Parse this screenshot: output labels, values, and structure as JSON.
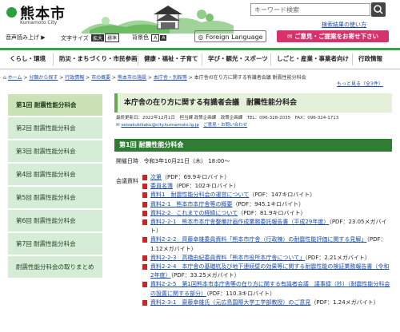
{
  "header": {
    "logo_title": "熊本市",
    "logo_sub": "Kumamoto City",
    "search_placeholder": "キーワード検索",
    "search_detail_link": "検索結果の使い方",
    "voice": "音声読み上げ",
    "text_size_label": "文字サイズ",
    "text_size_large": "拡大",
    "text_size_standard": "標準",
    "bg_color_label": "背景色",
    "bg_a1": "A",
    "bg_a2": "A",
    "language": "Foreign Language",
    "opinion": "ご意見・ご提案をお寄せ下さい"
  },
  "nav": [
    "くらし・環境",
    "防災・まちづくり・市民参画",
    "健康・福祉・子育て",
    "学び・観光・スポーツ",
    "しごと・産業・事業者向け",
    "行政情報"
  ],
  "breadcrumb": [
    "ホーム",
    "分類から探す",
    "行政情報",
    "市の概要",
    "熊本市の施設",
    "本庁舎・別館等"
  ],
  "breadcrumb_current": "本庁舎の在り方に関する有識者会議 耐震性能分科会",
  "upper_link": "もっと見る（全3件）",
  "sidebar": [
    "第1回 耐震性能分科会",
    "第2回 耐震性能分科会",
    "第3回 耐震性能分科会",
    "第4回 耐震性能分科会",
    "第5回 耐震性能分科会",
    "第6回 耐震性能分科会",
    "第7回 耐震性能分科会",
    "耐震性能分科会の取りまとめ"
  ],
  "main": {
    "title": "本庁舎の在り方に関する有識者会議　耐震性能分科会",
    "meta": "最終更新日：2022年12月1日　担当課 政策企画課　政策企画課　TEL：096-328-2035　FAX：096-324-1713",
    "meta_email": "seisakukikaku@city.kumamoto.lg.jp",
    "meta_form": "ご意見・お問い合わせ",
    "section": "第1回 耐震性能分科会",
    "date_label": "開催日時",
    "date_value": "令和3年10月21日（木） 18:00～",
    "docs_label": "会議資料"
  },
  "documents": [
    {
      "link": "次第",
      "size": "（PDF：69.9キロバイト）"
    },
    {
      "link": "委員名簿",
      "size": "（PDF：102キロバイト）"
    },
    {
      "link": "資料1　耐震性能分科会の運営について",
      "size": "（PDF：147キロバイト）"
    },
    {
      "link": "資料2-1　熊本市本庁舎等の概要",
      "size": "（PDF：945.1キロバイト）"
    },
    {
      "link": "資料2-2　これまでの経緯について",
      "size": "（PDF：81.9キロバイト）"
    },
    {
      "link": "資料2-2-1　熊本市本庁舎整備計画作成業務委託報告書（平成29年度）",
      "size": "（PDF：23.05メガバイト）"
    },
    {
      "link": "資料2-2-2　齊藤幸雄委員資料「熊本市庁舎（行政棟）の耐震性能評価に関する見解」",
      "size": "（PDF：1.12メガバイト）"
    },
    {
      "link": "資料2-2-3　高橋由紀委員資料「熊本市役所本庁舎について」",
      "size": "（PDF：2.21メガバイト）"
    },
    {
      "link": "資料2-2-4　本庁舎の基礎杭及び地下連続壁の効果等に関する耐震性能の検証業務報告書（令和2年度）",
      "size": "（PDF：33.25メガバイト）"
    },
    {
      "link": "資料2-2-5　第1回熊本市本庁舎等の在り方に関する有識者会議　議事録（抄）（耐震性能分科会の設置に関する部分）",
      "size": "（PDF：110.3キロバイト）"
    },
    {
      "link": "資料2-3-1　齋藤幸雄氏（元広島国際大学工学部教授）のご意見",
      "size": "（PDF：1.24メガバイト）"
    }
  ]
}
